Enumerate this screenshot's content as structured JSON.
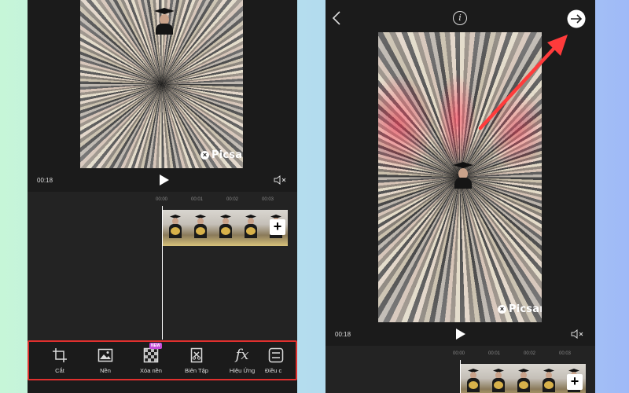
{
  "left_screen": {
    "watermark": "Picsart",
    "time_current": "00:18",
    "ruler": [
      "00:00",
      "00:01",
      "00:02",
      "00:03"
    ],
    "toolbar": [
      {
        "icon": "crop-icon",
        "label": "Cắt"
      },
      {
        "icon": "background-icon",
        "label": "Nền"
      },
      {
        "icon": "remove-bg-icon",
        "label": "Xóa nền",
        "badge": "NEW"
      },
      {
        "icon": "edit-icon",
        "label": "Biên Tập"
      },
      {
        "icon": "fx-icon",
        "label": "Hiệu Ứng"
      },
      {
        "icon": "adjust-icon",
        "label": "Điều c"
      }
    ],
    "fx_glyph": "fx"
  },
  "right_screen": {
    "watermark": "Picsart",
    "time_current": "00:18",
    "ruler": [
      "00:00",
      "00:01",
      "00:02",
      "00:03"
    ],
    "info_glyph": "i"
  },
  "colors": {
    "highlight": "#e0302e",
    "arrow": "#ff3b3b",
    "badge": "#c64bd9"
  }
}
